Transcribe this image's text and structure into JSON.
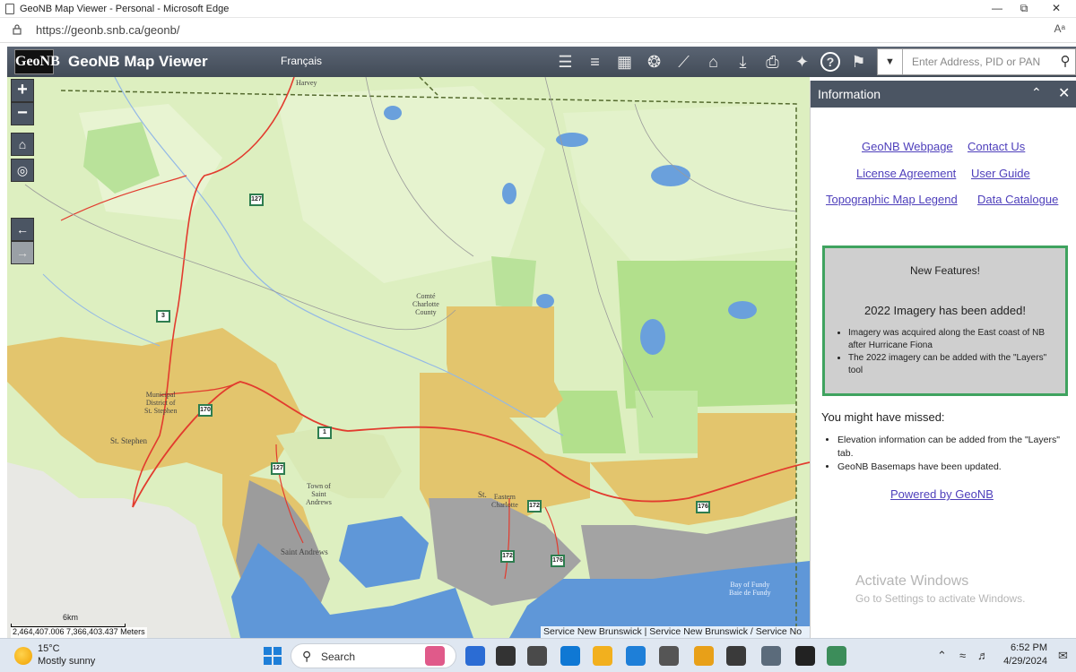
{
  "browser": {
    "window_title": "GeoNB Map Viewer - Personal - Microsoft Edge",
    "url": "https://geonb.snb.ca/geonb/",
    "read_aloud": "Aᵃ",
    "minimize": "—",
    "restore": "⧉",
    "close": "✕"
  },
  "app": {
    "logo_text": "GeoNB",
    "title": "GeoNB Map Viewer",
    "language_link": "Français",
    "tools": [
      {
        "name": "legend",
        "glyph": "☰"
      },
      {
        "name": "layers",
        "glyph": "≡"
      },
      {
        "name": "basemaps",
        "glyph": "▦"
      },
      {
        "name": "themes",
        "glyph": "❂"
      },
      {
        "name": "measure",
        "glyph": "⟋"
      },
      {
        "name": "education",
        "glyph": "⌂"
      },
      {
        "name": "download",
        "glyph": "⤓"
      },
      {
        "name": "print",
        "glyph": "⎙"
      },
      {
        "name": "share",
        "glyph": "✦"
      },
      {
        "name": "help",
        "glyph": "?"
      },
      {
        "name": "info",
        "glyph": "⚑"
      }
    ],
    "search_placeholder": "Enter Address, PID or PAN",
    "search_dropdown": "▼",
    "search_button": "⚲"
  },
  "map": {
    "zoom_in": "+",
    "zoom_out": "−",
    "home": "⌂",
    "locate": "◎",
    "back": "←",
    "forward": "→",
    "scale_label": "6km",
    "coordinates": "2,464,407.006 7,366,403.437 Meters",
    "attribution": "Service New Brunswick | Service New Brunswick / Service No",
    "places": [
      {
        "name": "Harvey"
      },
      {
        "name": "Comté\nCharlotte\nCounty"
      },
      {
        "name": "Municipal\nDistrict of\nSt. Stephen"
      },
      {
        "name": "St. Stephen"
      },
      {
        "name": "Town of\nSaint\nAndrews"
      },
      {
        "name": "Saint Andrews"
      },
      {
        "name": "St."
      },
      {
        "name": "Eastern\nCharlotte"
      },
      {
        "name": "Bay of Fundy\nBaie de Fundy"
      }
    ],
    "routes": [
      "127",
      "3",
      "170",
      "1",
      "127",
      "172",
      "172",
      "176",
      "176"
    ]
  },
  "info_panel": {
    "title": "Information",
    "collapse": "⌃",
    "close": "✕",
    "links": {
      "webpage": "GeoNB Webpage",
      "contact": "Contact Us",
      "license": "License Agreement",
      "guide": "User Guide",
      "legend": "Topographic Map Legend",
      "catalogue": "Data Catalogue",
      "powered": "Powered by GeoNB"
    },
    "new_features": {
      "heading": "New Features!",
      "subheading": "2022 Imagery has been added!",
      "items": [
        "Imagery was acquired along the East coast of NB after Hurricane Fiona",
        "The 2022 imagery can be added with the \"Layers\" tool"
      ]
    },
    "missed": {
      "heading": "You might have missed:",
      "items": [
        "Elevation information can be added from the \"Layers\" tab.",
        "GeoNB Basemaps have been updated."
      ]
    },
    "watermark_title": "Activate Windows",
    "watermark_sub": "Go to Settings to activate Windows."
  },
  "taskbar": {
    "temperature": "15°C",
    "weather": "Mostly sunny",
    "search_label": "Search",
    "time": "6:52 PM",
    "date": "4/29/2024",
    "app_colors": [
      "#e05a8a",
      "#2b6cd4",
      "#333333",
      "#4a4a4a",
      "#0f78d4",
      "#f2b01e",
      "#1e7fd8",
      "#555555",
      "#e8a018",
      "#3a3a3a",
      "#5b6b7b",
      "#222222",
      "#3c8d5a"
    ]
  },
  "colors": {
    "header": "#4b5563",
    "map_land": "#ddefc0",
    "map_yellow": "#e3c56d",
    "water": "#5f97d8",
    "feature_border": "#3fa35f",
    "link": "#4e3fbb"
  }
}
